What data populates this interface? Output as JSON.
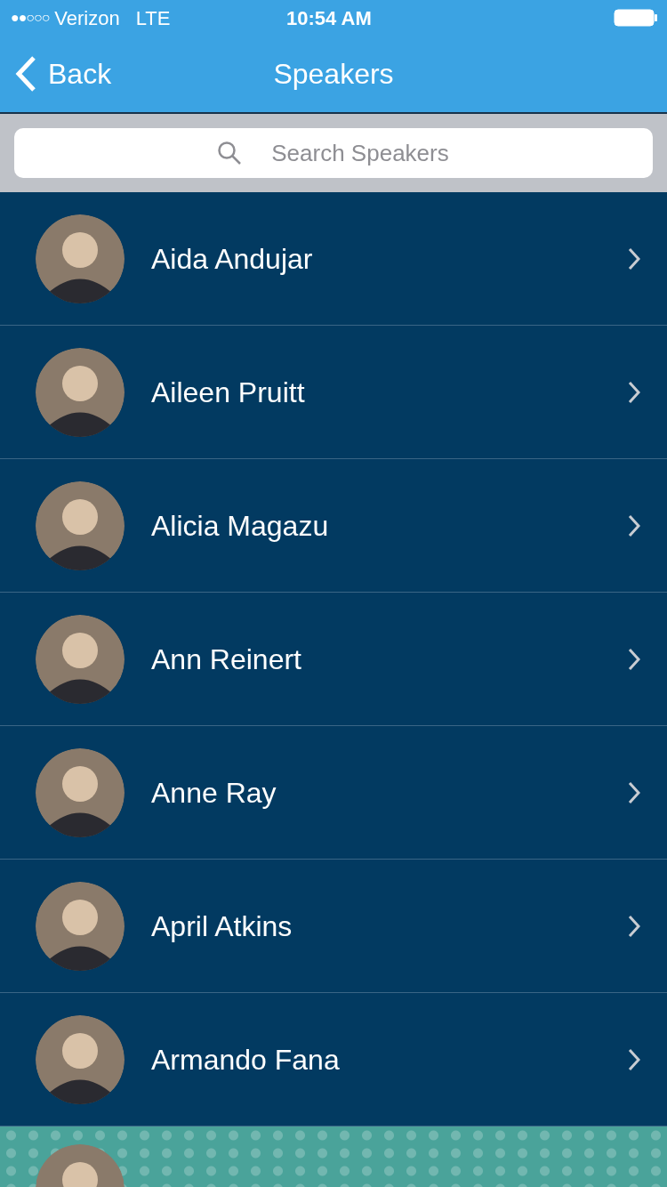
{
  "status_bar": {
    "signal_dots": "●●○○○",
    "carrier": "Verizon",
    "network": "LTE",
    "time": "10:54 AM"
  },
  "nav_bar": {
    "back": "Back",
    "title": "Speakers"
  },
  "search": {
    "placeholder": "Search Speakers"
  },
  "speakers": [
    {
      "kind": "row",
      "name": "Aida Andujar"
    },
    {
      "kind": "row",
      "name": "Aileen Pruitt"
    },
    {
      "kind": "row",
      "name": "Alicia Magazu"
    },
    {
      "kind": "row",
      "name": "Ann Reinert"
    },
    {
      "kind": "row",
      "name": "Anne Ray"
    },
    {
      "kind": "row",
      "name": "April Atkins"
    },
    {
      "kind": "row",
      "name": "Armando Fana"
    },
    {
      "kind": "avatar_only"
    }
  ]
}
